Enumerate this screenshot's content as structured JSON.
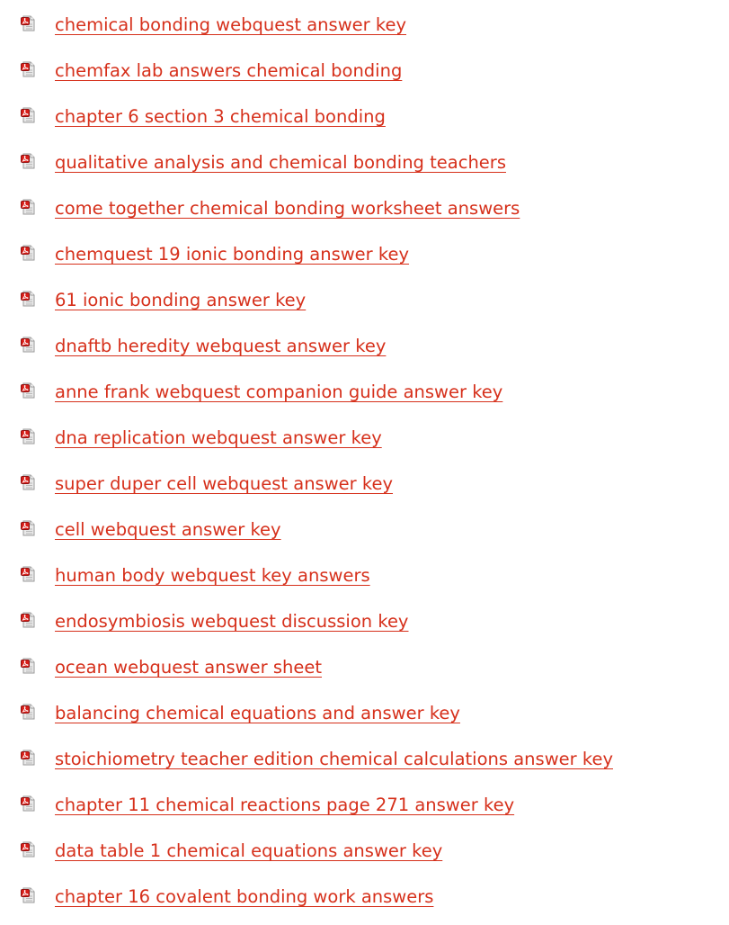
{
  "links": [
    {
      "label": "chemical bonding webquest answer key",
      "icon": "pdf-file-icon"
    },
    {
      "label": "chemfax lab answers chemical bonding",
      "icon": "pdf-file-icon"
    },
    {
      "label": "chapter 6 section 3 chemical bonding",
      "icon": "pdf-file-icon"
    },
    {
      "label": "qualitative analysis and chemical bonding teachers",
      "icon": "pdf-file-icon"
    },
    {
      "label": "come together chemical bonding worksheet answers",
      "icon": "pdf-file-icon"
    },
    {
      "label": "chemquest 19 ionic bonding answer key",
      "icon": "pdf-file-icon"
    },
    {
      "label": "61 ionic bonding answer key",
      "icon": "pdf-file-icon"
    },
    {
      "label": "dnaftb heredity webquest answer key",
      "icon": "pdf-file-icon"
    },
    {
      "label": "anne frank webquest companion guide answer key",
      "icon": "pdf-file-icon"
    },
    {
      "label": "dna replication webquest answer key",
      "icon": "pdf-file-icon"
    },
    {
      "label": "super duper cell webquest answer key",
      "icon": "pdf-file-icon"
    },
    {
      "label": "cell webquest answer key",
      "icon": "pdf-file-icon"
    },
    {
      "label": "human body webquest key answers",
      "icon": "pdf-file-icon"
    },
    {
      "label": "endosymbiosis webquest discussion key",
      "icon": "pdf-file-icon"
    },
    {
      "label": "ocean webquest answer sheet",
      "icon": "pdf-file-icon"
    },
    {
      "label": "balancing chemical equations and answer key",
      "icon": "pdf-file-icon"
    },
    {
      "label": "stoichiometry teacher edition chemical calculations answer key",
      "icon": "pdf-file-icon"
    },
    {
      "label": "chapter 11 chemical reactions page 271 answer key",
      "icon": "pdf-file-icon"
    },
    {
      "label": "data table 1 chemical equations answer key",
      "icon": "pdf-file-icon"
    },
    {
      "label": "chapter 16 covalent bonding work answers",
      "icon": "pdf-file-icon"
    }
  ],
  "colors": {
    "link": "#d6301b",
    "icon_red": "#d91e18",
    "icon_page": "#e9e9e9"
  }
}
